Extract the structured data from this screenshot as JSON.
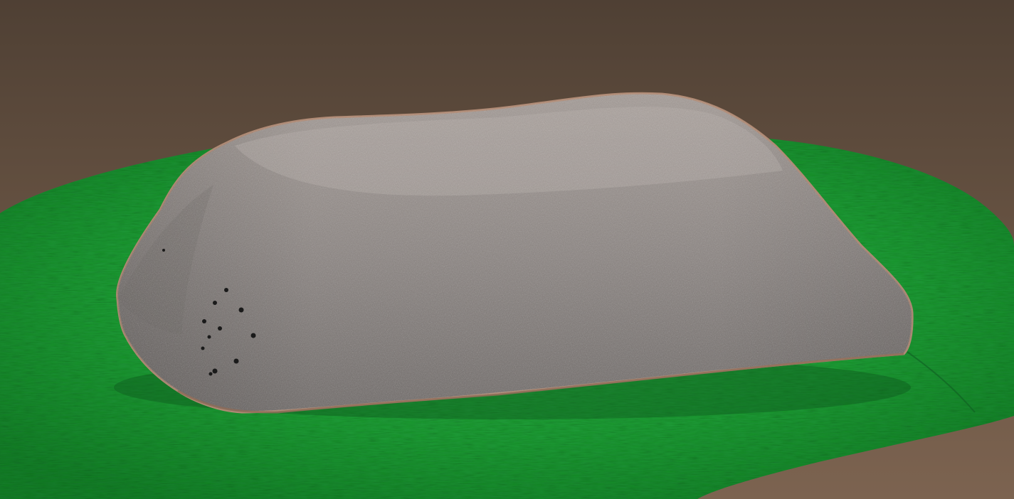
{
  "scene": {
    "subject": "artificial-rock-cover",
    "colors": {
      "background_top": "#4f4034",
      "background_bottom": "#7c6350",
      "grass_light": "#2fb24a",
      "grass_mid": "#1f9a3a",
      "grass_dark": "#157a2c",
      "rock_light": "#a39a95",
      "rock_mid": "#8a8380",
      "rock_dark": "#6d6866",
      "rock_edge": "#b08a74",
      "hole": "#1a1a1a"
    },
    "vent_hole_count": 12
  }
}
